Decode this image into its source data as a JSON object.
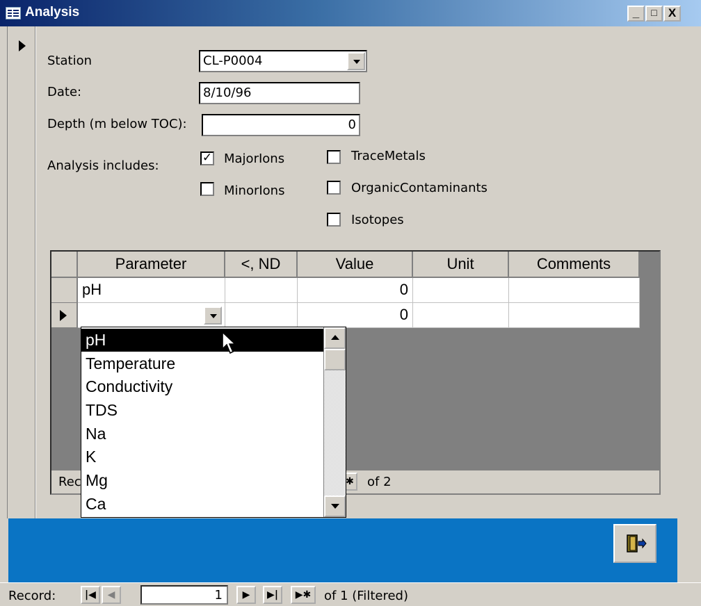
{
  "window": {
    "title": "Analysis",
    "controls": [
      "_",
      "□",
      "X"
    ]
  },
  "form": {
    "station_label": "Station",
    "station_value": "CL-P0004",
    "date_label": "Date:",
    "date_value": "8/10/96",
    "depth_label": "Depth (m below TOC):",
    "depth_value": "0",
    "includes_label": "Analysis includes:",
    "checkboxes": [
      {
        "label": "MajorIons",
        "checked": true
      },
      {
        "label": "MinorIons",
        "checked": false
      },
      {
        "label": "TraceMetals",
        "checked": false
      },
      {
        "label": "OrganicContaminants",
        "checked": false
      },
      {
        "label": "Isotopes",
        "checked": false
      }
    ]
  },
  "subform": {
    "columns": [
      "Parameter",
      "<, ND",
      "Value",
      "Unit",
      "Comments"
    ],
    "rows": [
      {
        "parameter": "pH",
        "nd": "",
        "value": "0",
        "unit": "",
        "comments": ""
      },
      {
        "parameter": "",
        "nd": "",
        "value": "0",
        "unit": "",
        "comments": ""
      }
    ],
    "nav_label_partial": "Rec",
    "nav_of": "of  2"
  },
  "dropdown": {
    "items": [
      "pH",
      "Temperature",
      "Conductivity",
      "TDS",
      "Na",
      "K",
      "Mg",
      "Ca"
    ],
    "selected": "pH"
  },
  "nav": {
    "record_label": "Record:",
    "current": "1",
    "of_text": "of  1 (Filtered)"
  },
  "colors": {
    "band": "#0a74c4",
    "titlebar": "#0a246a",
    "background": "#d4d0c8"
  }
}
